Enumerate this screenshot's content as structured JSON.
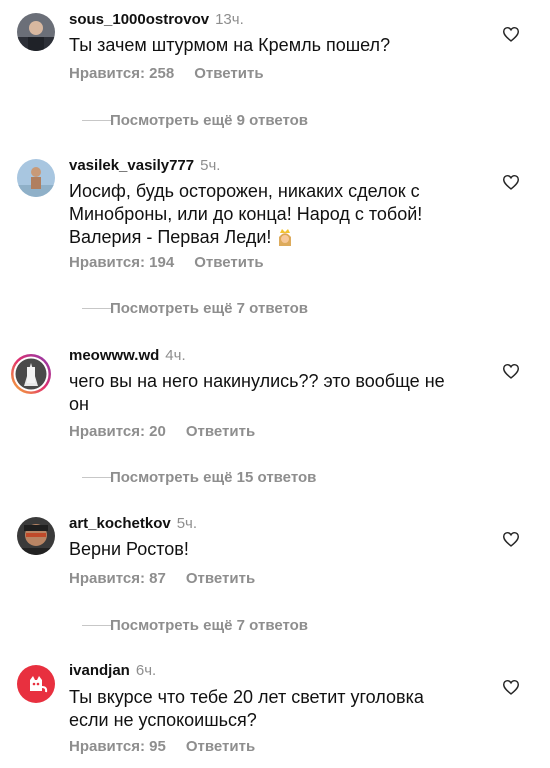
{
  "comments": [
    {
      "username": "sous_1000ostrovov",
      "time": "13ч.",
      "text": "Ты зачем штурмом на Кремль пошел?",
      "likes": "Нравится: 258",
      "reply": "Ответить",
      "more": "Посмотреть ещё 9 ответов"
    },
    {
      "username": "vasilek_vasily777",
      "time": "5ч.",
      "text_lines": [
        "Иосиф, будь осторожен, никаких сделок с",
        "Миноброны, или до конца! Народ с тобой!",
        "Валерия - Первая Леди!"
      ],
      "likes": "Нравится: 194",
      "reply": "Ответить",
      "more": "Посмотреть ещё 7 ответов"
    },
    {
      "username": "meowww.wd",
      "time": "4ч.",
      "text_lines": [
        "чего вы на него накинулись?? это вообще не",
        "он"
      ],
      "likes": "Нравится: 20",
      "reply": "Ответить",
      "more": "Посмотреть ещё 15 ответов"
    },
    {
      "username": "art_kochetkov",
      "time": "5ч.",
      "text": "Верни Ростов!",
      "likes": "Нравится: 87",
      "reply": "Ответить",
      "more": "Посмотреть ещё 7 ответов"
    },
    {
      "username": "ivandjan",
      "time": "6ч.",
      "text_lines": [
        "Ты вкурсе что тебе 20 лет светит уголовка",
        "если не успокоишься?"
      ],
      "likes": "Нравится: 95",
      "reply": "Ответить"
    }
  ],
  "icons": {
    "like": "heart-outline-icon",
    "emoji": "princess-emoji"
  },
  "colors": {
    "muted": "#8e8e8e",
    "text": "#111111",
    "divider": "#c7c7c7"
  }
}
